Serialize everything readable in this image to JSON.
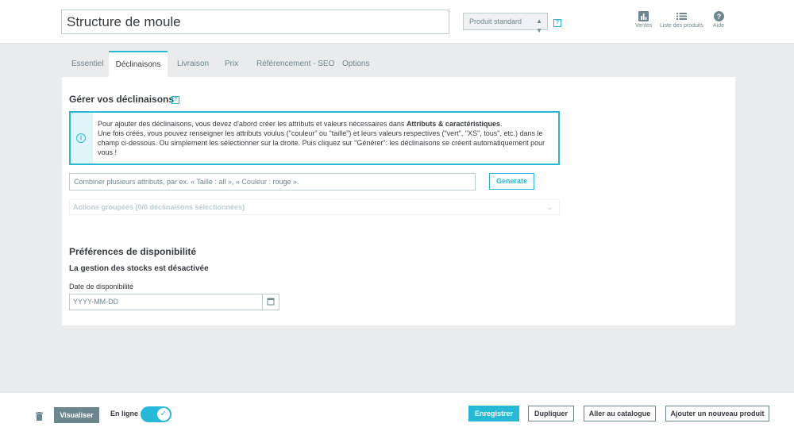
{
  "header": {
    "product_name": "Structure de moule",
    "product_type": "Produit standard",
    "help_mark": "?",
    "links": [
      {
        "label": "Ventes",
        "icon": "bar-chart-icon"
      },
      {
        "label": "Liste des produits",
        "icon": "list-icon"
      },
      {
        "label": "Aide",
        "icon": "help-circle-icon"
      }
    ]
  },
  "tabs": [
    {
      "label": "Essentiel"
    },
    {
      "label": "Déclinaisons",
      "active": true
    },
    {
      "label": "Livraison"
    },
    {
      "label": "Prix"
    },
    {
      "label": "Référencement - SEO"
    },
    {
      "label": "Options"
    }
  ],
  "combinations": {
    "title": "Gérer vos déclinaisons",
    "help_mark": "?",
    "info_line1_prefix": "Pour ajouter des déclinaisons, vous devez d'abord créer les attributs et valeurs nécessaires dans ",
    "info_line1_bold": "Attributs & caractéristiques",
    "info_line1_suffix": ".",
    "info_rest": "Une fois créés, vous pouvez renseigner les attributs voulus (\"couleur\" ou \"taille\") et leurs valeurs respectives (\"vert\", \"XS\", tous\", etc.) dans le champ ci-dessous. Ou simplement les sélectionner sur la droite. Puis cliquez sur \"Générer\": les déclinaisons se créent automatiquement pour vous !",
    "combine_placeholder": "Combiner plusieurs attributs, par ex. « Taille : all », « Couleur : rouge ».",
    "generate_label": "Generate",
    "bulk_actions_label": "Actions groupées (0/0 déclinaisons sélectionnées)"
  },
  "availability": {
    "title": "Préférences de disponibilité",
    "stock_status": "La gestion des stocks est désactivée",
    "date_label": "Date de disponibilité",
    "date_placeholder": "YYYY-MM-DD"
  },
  "footer": {
    "preview_label": "Visualiser",
    "online_label": "En ligne",
    "online_enabled": true,
    "save_label": "Enregistrer",
    "duplicate_label": "Dupliquer",
    "catalog_label": "Aller au catalogue",
    "new_product_label": "Ajouter un nouveau produit"
  },
  "colors": {
    "accent": "#25b9d7",
    "text": "#363a41",
    "muted": "#6c868e",
    "background": "#eaebec"
  }
}
